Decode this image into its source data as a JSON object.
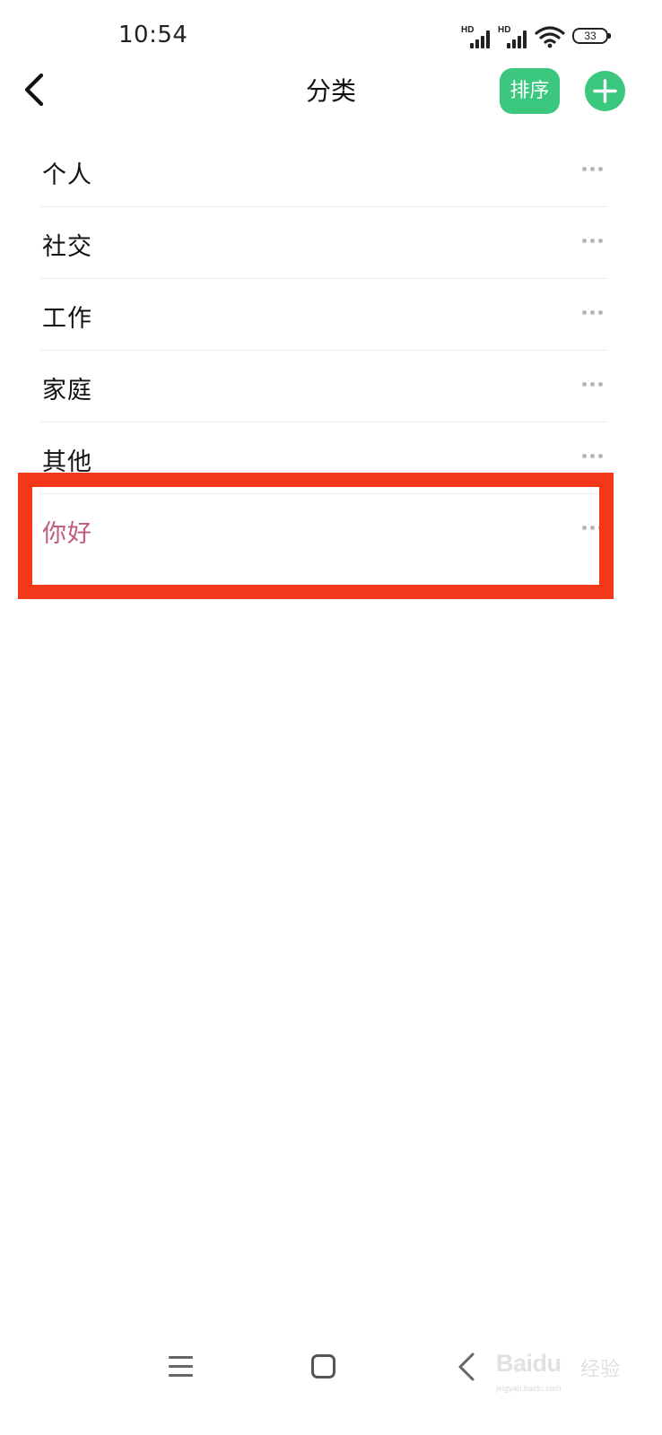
{
  "status_bar": {
    "time": "10:54",
    "signal_1_label": "HD",
    "signal_2_label": "HD",
    "battery": "33",
    "icons": [
      "signal-icon",
      "signal-icon",
      "wifi-icon",
      "battery-icon"
    ]
  },
  "header": {
    "back_icon": "chevron-left-icon",
    "title": "分类",
    "sort_label": "排序",
    "add_icon": "plus-icon",
    "accent_color": "#3cc77e"
  },
  "categories": [
    {
      "label": "个人",
      "more_icon": "more-horizontal-icon"
    },
    {
      "label": "社交",
      "more_icon": "more-horizontal-icon"
    },
    {
      "label": "工作",
      "more_icon": "more-horizontal-icon"
    },
    {
      "label": "家庭",
      "more_icon": "more-horizontal-icon"
    },
    {
      "label": "其他",
      "more_icon": "more-horizontal-icon"
    },
    {
      "label": "你好",
      "more_icon": "more-horizontal-icon",
      "highlighted": true,
      "label_color": "#c0597e"
    }
  ],
  "annotation": {
    "frame_color": "#f2371a"
  },
  "nav_bar": {
    "icons": [
      "menu-icon",
      "home-icon",
      "back-icon"
    ]
  },
  "watermark": {
    "brand": "Baidu",
    "suffix": "经验",
    "url": "jingyan.baidu.com"
  }
}
